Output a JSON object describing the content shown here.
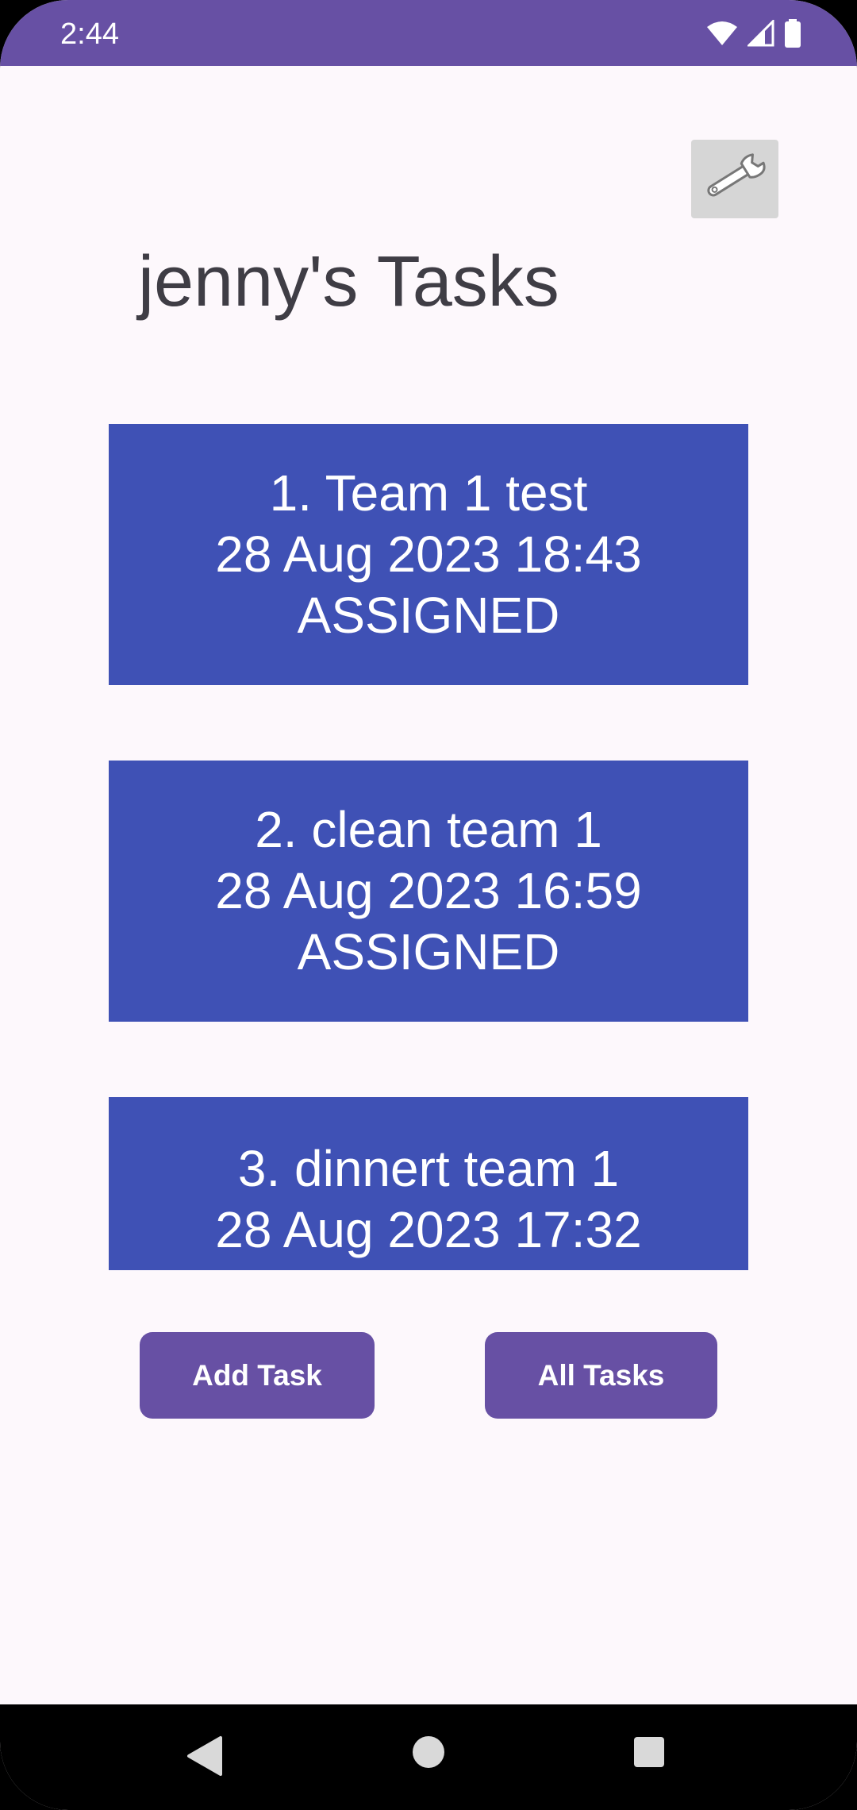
{
  "status_bar": {
    "time": "2:44",
    "icons": [
      "wifi-icon",
      "signal-icon",
      "battery-icon"
    ]
  },
  "toolbar": {
    "settings_icon": "wrench-icon"
  },
  "page": {
    "title": "jenny's Tasks"
  },
  "tasks": [
    {
      "title": "1. Team 1 test",
      "datetime": "28 Aug 2023 18:43",
      "status": "ASSIGNED"
    },
    {
      "title": "2. clean team 1",
      "datetime": "28 Aug 2023 16:59",
      "status": "ASSIGNED"
    },
    {
      "title": "3. dinnert team 1",
      "datetime": "28 Aug 2023 17:32",
      "status": ""
    }
  ],
  "buttons": {
    "add_task": "Add Task",
    "all_tasks": "All Tasks"
  },
  "nav": {
    "icons": [
      "back-icon",
      "home-icon",
      "recents-icon"
    ]
  },
  "colors": {
    "accent": "#6750a4",
    "card": "#3f51b5",
    "background": "#fdf8fc"
  }
}
